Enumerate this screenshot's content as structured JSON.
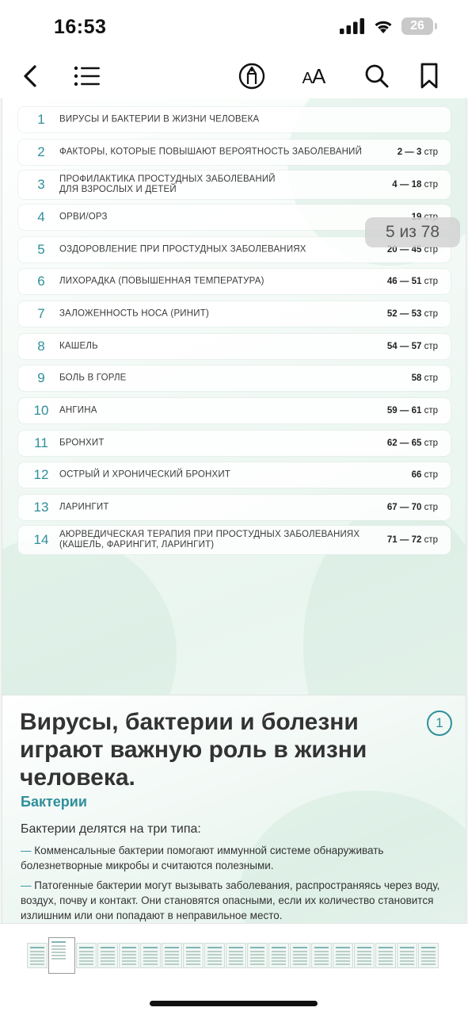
{
  "status_bar": {
    "time": "16:53",
    "battery": "26"
  },
  "toolbar": {
    "font_size_label_small": "A",
    "font_size_label_large": "A"
  },
  "toc": {
    "items": [
      {
        "num": "1",
        "title": "ВИРУСЫ И БАКТЕРИИ В ЖИЗНИ ЧЕЛОВЕКА",
        "pages": "",
        "unit": ""
      },
      {
        "num": "2",
        "title": "ФАКТОРЫ, КОТОРЫЕ ПОВЫШАЮТ ВЕРОЯТНОСТЬ ЗАБОЛЕВАНИЙ",
        "pages": "2 — 3",
        "unit": "стр"
      },
      {
        "num": "3",
        "title": "ПРОФИЛАКТИКА ПРОСТУДНЫХ ЗАБОЛЕВАНИЙ ДЛЯ ВЗРОСЛЫХ И ДЕТЕЙ",
        "pages": "4 — 18",
        "unit": "стр"
      },
      {
        "num": "4",
        "title": "ОРВИ/ОРЗ",
        "pages": "19",
        "unit": "стр"
      },
      {
        "num": "5",
        "title": "ОЗДОРОВЛЕНИЕ ПРИ ПРОСТУДНЫХ ЗАБОЛЕВАНИЯХ",
        "pages": "20 — 45",
        "unit": "стр"
      },
      {
        "num": "6",
        "title": "ЛИХОРАДКА (ПОВЫШЕННАЯ ТЕМПЕРАТУРА)",
        "pages": "46 — 51",
        "unit": "стр"
      },
      {
        "num": "7",
        "title": "ЗАЛОЖЕННОСТЬ НОСА (РИНИТ)",
        "pages": "52 — 53",
        "unit": "стр"
      },
      {
        "num": "8",
        "title": "КАШЕЛЬ",
        "pages": "54 — 57",
        "unit": "стр"
      },
      {
        "num": "9",
        "title": "БОЛЬ В ГОРЛЕ",
        "pages": "58",
        "unit": "стр"
      },
      {
        "num": "10",
        "title": "АНГИНА",
        "pages": "59 — 61",
        "unit": "стр"
      },
      {
        "num": "11",
        "title": "БРОНХИТ",
        "pages": "62 — 65",
        "unit": "стр"
      },
      {
        "num": "12",
        "title": "ОСТРЫЙ И ХРОНИЧЕСКИЙ БРОНХИТ",
        "pages": "66",
        "unit": "стр"
      },
      {
        "num": "13",
        "title": "ЛАРИНГИТ",
        "pages": "67 — 70",
        "unit": "стр"
      },
      {
        "num": "14",
        "title": "АЮРВЕДИЧЕСКАЯ ТЕРАПИЯ ПРИ ПРОСТУДНЫХ ЗАБОЛЕВАНИЯХ (КАШЕЛЬ, ФАРИНГИТ, ЛАРИНГИТ)",
        "pages": "71 — 72",
        "unit": "стр"
      }
    ]
  },
  "page_indicator": "5 из 78",
  "page2": {
    "heading": "Вирусы, бактерии и болезни играют важную роль в жизни человека.",
    "badge": "1",
    "subheading": "Бактерии",
    "lead": "Бактерии делятся на три типа:",
    "bullets": [
      "Комменсальные бактерии помогают иммунной системе обнаруживать болезнетворные микробы и считаются полезными.",
      "Патогенные бактерии могут вызывать заболевания, распространяясь через воду, воздух, почву и контакт. Они становятся опасными, если их количество становится излишним или они попадают в неправильное место."
    ]
  },
  "colors": {
    "accent": "#2f8f9a",
    "page_bg": "#eef7f2"
  },
  "icons": [
    "back-chevron-icon",
    "table-of-contents-icon",
    "annotate-pen-icon",
    "search-icon",
    "bookmark-icon",
    "signal-icon",
    "wifi-icon",
    "battery-icon"
  ]
}
